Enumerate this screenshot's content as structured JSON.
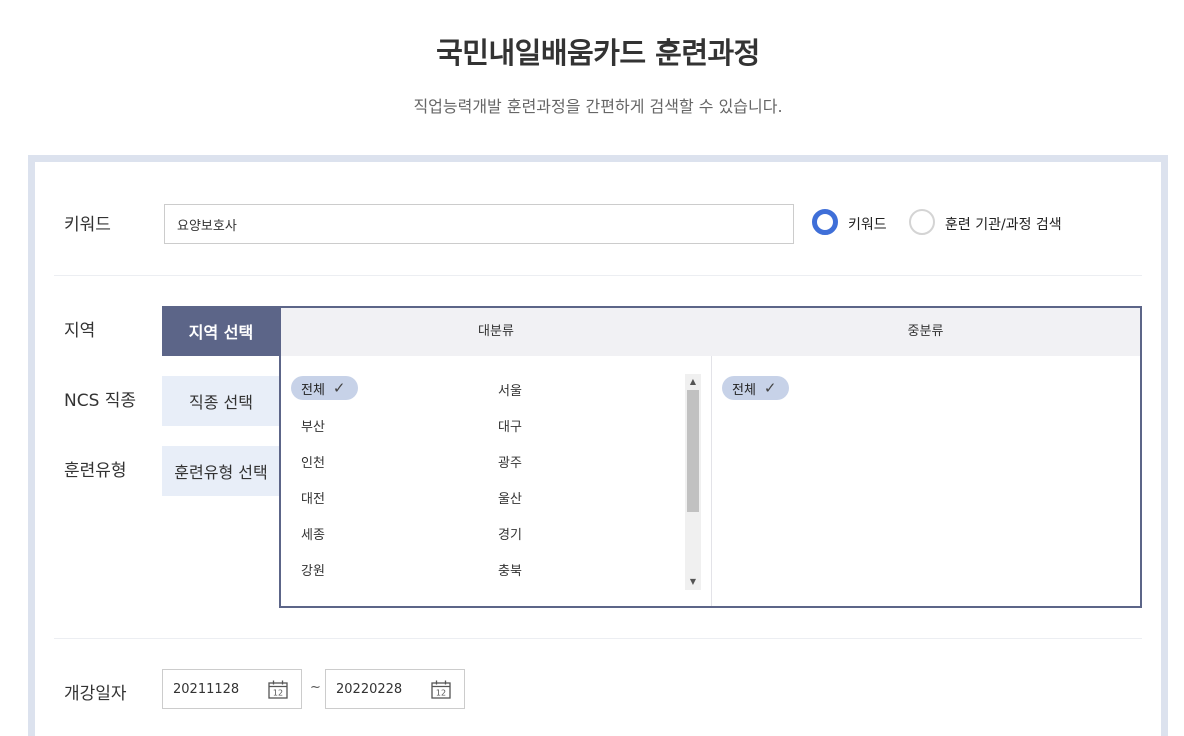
{
  "header": {
    "title": "국민내일배움카드 훈련과정",
    "subtitle": "직업능력개발 훈련과정을 간편하게 검색할 수 있습니다."
  },
  "keyword": {
    "label": "키워드",
    "value": "요양보호사",
    "radio_options": [
      {
        "label": "키워드",
        "selected": true
      },
      {
        "label": "훈련 기관/과정 검색",
        "selected": false
      }
    ]
  },
  "filters": {
    "region_label": "지역",
    "ncs_label": "NCS 직종",
    "type_label": "훈련유형",
    "tabs": [
      {
        "label": "지역 선택",
        "active": true
      },
      {
        "label": "직종 선택",
        "active": false
      },
      {
        "label": "훈련유형 선택",
        "active": false
      }
    ]
  },
  "region_box": {
    "major_header": "대분류",
    "minor_header": "중분류",
    "major_items": [
      "전체",
      "서울",
      "부산",
      "대구",
      "인천",
      "광주",
      "대전",
      "울산",
      "세종",
      "경기",
      "강원",
      "충북"
    ],
    "minor_items": [
      "전체"
    ],
    "selected_major": "전체",
    "selected_minor": "전체"
  },
  "dates": {
    "label": "개강일자",
    "start": "20211128",
    "separator": "~",
    "end": "20220228",
    "calendar_icon_text": "12"
  },
  "colors": {
    "accent": "#3f6fd8",
    "tab_active": "#5c6588",
    "tab_inactive": "#e8eef8",
    "chip": "#c7d2e8",
    "panel_border": "#dce2ee"
  }
}
